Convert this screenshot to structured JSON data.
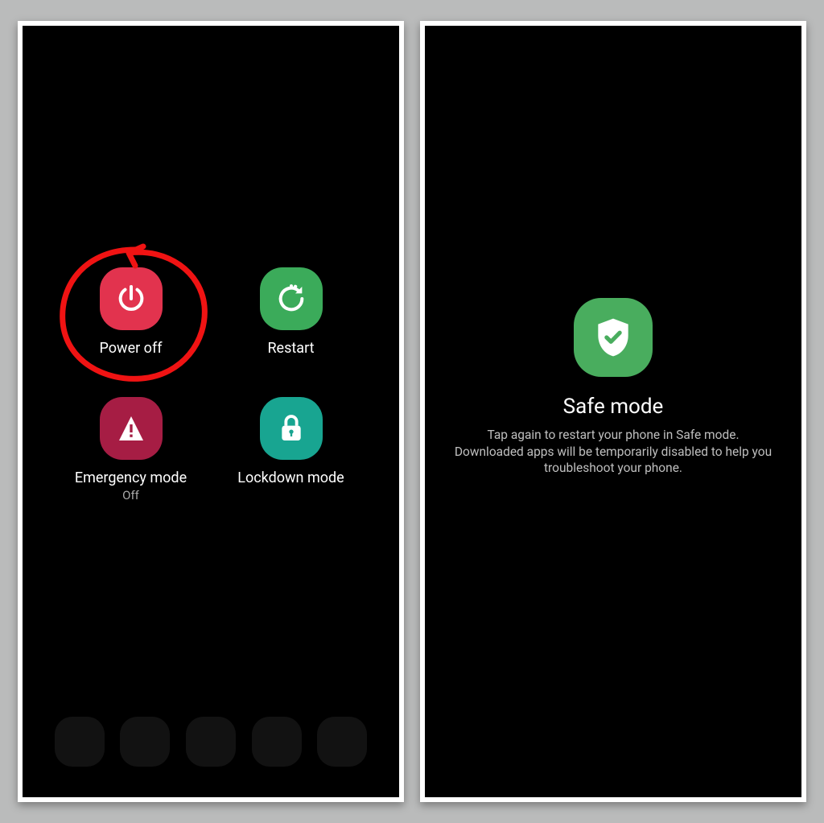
{
  "left": {
    "options": [
      {
        "label": "Power off",
        "sub": "",
        "icon": "power-icon",
        "color": "c-red"
      },
      {
        "label": "Restart",
        "sub": "",
        "icon": "restart-icon",
        "color": "c-green"
      },
      {
        "label": "Emergency mode",
        "sub": "Off",
        "icon": "emergency-icon",
        "color": "c-dark"
      },
      {
        "label": "Lockdown mode",
        "sub": "",
        "icon": "lockdown-icon",
        "color": "c-teal"
      }
    ],
    "annotation_color": "#f01313"
  },
  "right": {
    "title": "Safe mode",
    "description": "Tap again to restart your phone in Safe mode. Downloaded apps will be temporarily disabled to help you troubleshoot your phone.",
    "icon": "shield-check-icon",
    "icon_bg": "#49ad5e"
  }
}
